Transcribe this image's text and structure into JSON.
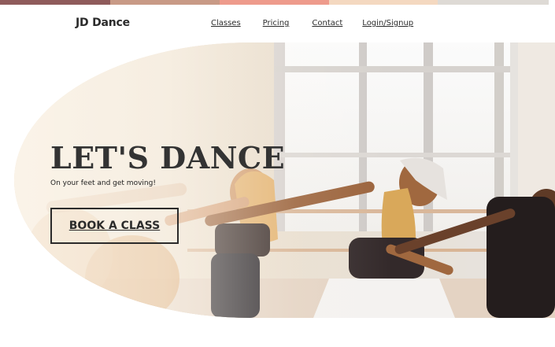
{
  "colors": {
    "stripe": [
      "#8f5b5b",
      "#c89a86",
      "#ee9b8c",
      "#f4d8c0",
      "#dedad5"
    ],
    "text": "#2b2b2b"
  },
  "header": {
    "brand": "JD Dance",
    "nav": {
      "classes": "Classes",
      "pricing": "Pricing",
      "contact": "Contact",
      "login": "Login/Signup"
    }
  },
  "hero": {
    "title": "LET'S DANCE",
    "subtitle": "On your feet and get moving!",
    "cta_label": "BOOK A CLASS"
  }
}
